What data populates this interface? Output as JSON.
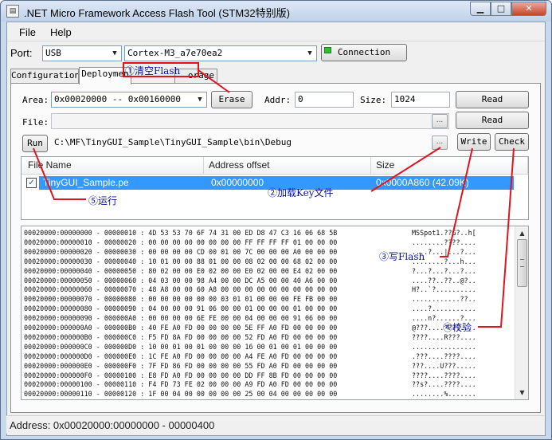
{
  "window": {
    "title": ".NET Micro Framework Access Flash Tool (STM32特别版)",
    "minimize_glyph": "▁",
    "maximize_glyph": "□",
    "close_glyph": "✕"
  },
  "menu": {
    "file": "File",
    "help": "Help"
  },
  "port_row": {
    "port_label": "Port:",
    "port_value": "USB",
    "device_value": "Cortex-M3_a7e70ea2",
    "connection_label": "Connection"
  },
  "tabs": [
    "Configuration",
    "Deploymen",
    "①清空Flash",
    "orage"
  ],
  "deployment": {
    "area_label": "Area:",
    "area_value": "0x00020000 -- 0x00160000",
    "erase_label": "Erase",
    "addr_label": "Addr:",
    "addr_value": "0",
    "size_label": "Size:",
    "size_value": "1024",
    "read_label_1": "Read",
    "read_label_2": "Read",
    "file_label": "File:",
    "file_value": "",
    "run_label": "Run",
    "path_value": "C:\\MF\\TinyGUI_Sample\\TinyGUI_Sample\\bin\\Debug",
    "write_label": "Write",
    "check_label": "Check",
    "browse_glyph": "..."
  },
  "file_table": {
    "columns": [
      "File Name",
      "Address offset",
      "Size"
    ],
    "rows": [
      {
        "checked": true,
        "name": "TinyGUI_Sample.pe",
        "offset": "0x00000000",
        "size": "0x0000A860 (42.09K)"
      }
    ]
  },
  "hex_dump": {
    "lines": [
      "00020000:00000000 - 00000010 : 4D 53 53 70 6F 74 31 00 ED D8 47 C3 16 06 68 5B",
      "00020000:00000010 - 00000020 : 00 00 00 00 00 00 00 00 FF FF FF FF 01 00 00 00",
      "00020000:00000020 - 00000030 : 00 00 00 00 CD 00 01 00 7C 00 00 00 A0 00 00 00",
      "00020000:00000030 - 00000040 : 10 01 00 00 88 01 00 00 08 02 00 00 68 02 00 00",
      "00020000:00000040 - 00000050 : 80 02 00 00 E0 02 00 00 E0 02 00 00 E4 02 00 00",
      "00020000:00000050 - 00000060 : 04 03 00 00 98 A4 00 00 DC A5 00 00 40 A6 00 00",
      "00020000:00000060 - 00000070 : 48 A8 00 00 60 A8 00 00 00 00 00 00 00 00 00 00",
      "00020000:00000070 - 00000080 : 00 00 00 00 00 00 03 01 01 00 00 00 FE FB 00 00",
      "00020000:00000080 - 00000090 : 04 00 00 00 91 06 00 00 01 00 00 00 01 00 00 00",
      "00020000:00000090 - 000000A0 : 00 00 00 00 6E FE 00 00 04 00 00 00 91 06 00 00",
      "00020000:000000A0 - 000000B0 : 40 FE A0 FD 00 00 00 00 5E FF A0 FD 00 00 00 00",
      "00020000:000000B0 - 000000C0 : F5 FD 8A FD 00 00 00 00 52 FD A0 FD 00 00 00 00",
      "00020000:000000C0 - 000000D0 : 10 00 01 00 01 00 00 00 16 00 01 00 01 00 00 00",
      "00020000:000000D0 - 000000E0 : 1C FE A0 FD 00 00 00 00 A4 FE A0 FD 00 00 00 00",
      "00020000:000000E0 - 000000F0 : 7F FD 86 FD 00 00 00 00 55 FD A0 FD 00 00 00 00",
      "00020000:000000F0 - 00000100 : E8 FD A0 FD 00 00 00 00 DD FF 8B FD 00 00 00 00",
      "00020000:00000100 - 00000110 : F4 FD 73 FE 02 00 00 00 A9 FD A0 FD 00 00 00 00",
      "00020000:00000110 - 00000120 : 1F 00 04 00 00 00 00 00 25 00 04 00 00 00 00 00"
    ],
    "ascii": [
      "MSSpot1.??G?..h[",
      "........????....",
      "....?...|...?...",
      "........?...h...",
      "?...?...?...?...",
      "....??..??..@?..",
      "H?..`?..........",
      "............??..",
      "....?...........",
      "....n?......?...",
      "@???....^???....",
      "????....R???....",
      "................",
      ".???....????....",
      "???....U???.....",
      "????....????....",
      "??s?....????....",
      "........%......."
    ]
  },
  "statusbar": {
    "text": "Address:  0x00020000:00000000 - 00000400"
  },
  "annotations": {
    "clear_flash": "①清空Flash",
    "load_key_file": "②加载Key文件",
    "write_flash": "③写Flash",
    "verify": "④校验",
    "run": "⑤运行"
  },
  "colors": {
    "annotation_line": "#e0141e",
    "annotation_text": "#0a14a0",
    "selection": "#3399ff",
    "led": "#2ec12e"
  }
}
